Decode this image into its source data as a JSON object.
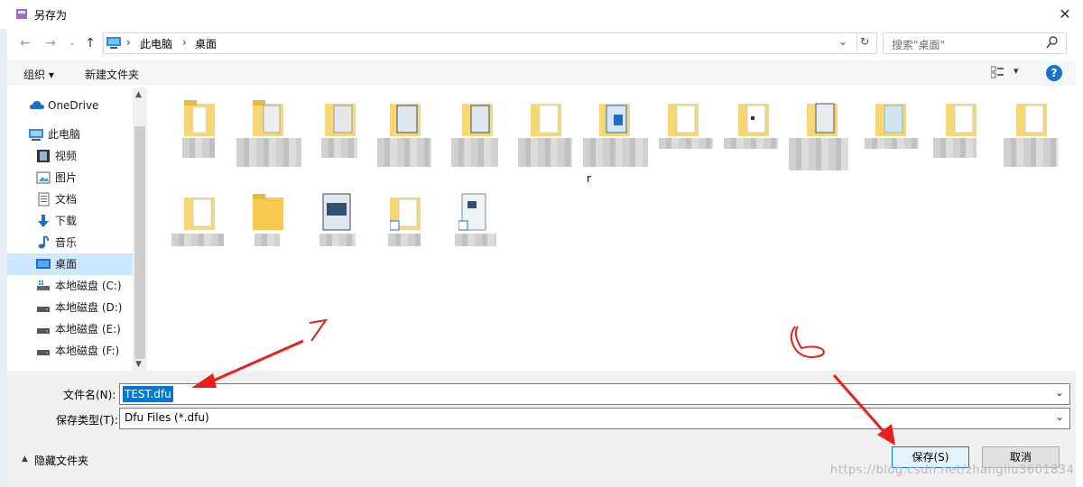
{
  "window": {
    "title": "另存为",
    "close_label": "✕"
  },
  "address_bar": {
    "path": [
      "此电脑",
      "桌面"
    ],
    "separator": "›",
    "search_placeholder": "搜索\"桌面\""
  },
  "toolbar": {
    "organize_label": "组织 ▾",
    "new_folder_label": "新建文件夹",
    "help_label": "?"
  },
  "nav": {
    "items": [
      {
        "label": "OneDrive",
        "icon": "cloud-icon"
      },
      {
        "label": "此电脑",
        "icon": "computer-icon"
      },
      {
        "label": "视频",
        "icon": "video-icon"
      },
      {
        "label": "图片",
        "icon": "picture-icon"
      },
      {
        "label": "文档",
        "icon": "document-icon"
      },
      {
        "label": "下载",
        "icon": "download-icon"
      },
      {
        "label": "音乐",
        "icon": "music-icon"
      },
      {
        "label": "桌面",
        "icon": "desktop-icon",
        "selected": true
      },
      {
        "label": "本地磁盘 (C:)",
        "icon": "drive-icon"
      },
      {
        "label": "本地磁盘 (D:)",
        "icon": "drive-icon"
      },
      {
        "label": "本地磁盘 (E:)",
        "icon": "drive-icon"
      },
      {
        "label": "本地磁盘 (F:)",
        "icon": "drive-icon"
      }
    ]
  },
  "content": {
    "stray_char": "r"
  },
  "form": {
    "filename_label": "文件名(N):",
    "filename_value": "TEST.dfu",
    "filetype_label": "保存类型(T):",
    "filetype_value": "Dfu Files (*.dfu)"
  },
  "footer": {
    "hide_folders_label": "隐藏文件夹",
    "save_label": "保存(S)",
    "cancel_label": "取消",
    "watermark": "https://blog.csdn.net/zhangliu3601834"
  },
  "annotations": {
    "mark_1": "7",
    "mark_2": "8"
  },
  "colors": {
    "accent": "#0078d7",
    "selection": "#cce8ff",
    "annotation": "#e8201a",
    "help_blue": "#1a73c9"
  }
}
